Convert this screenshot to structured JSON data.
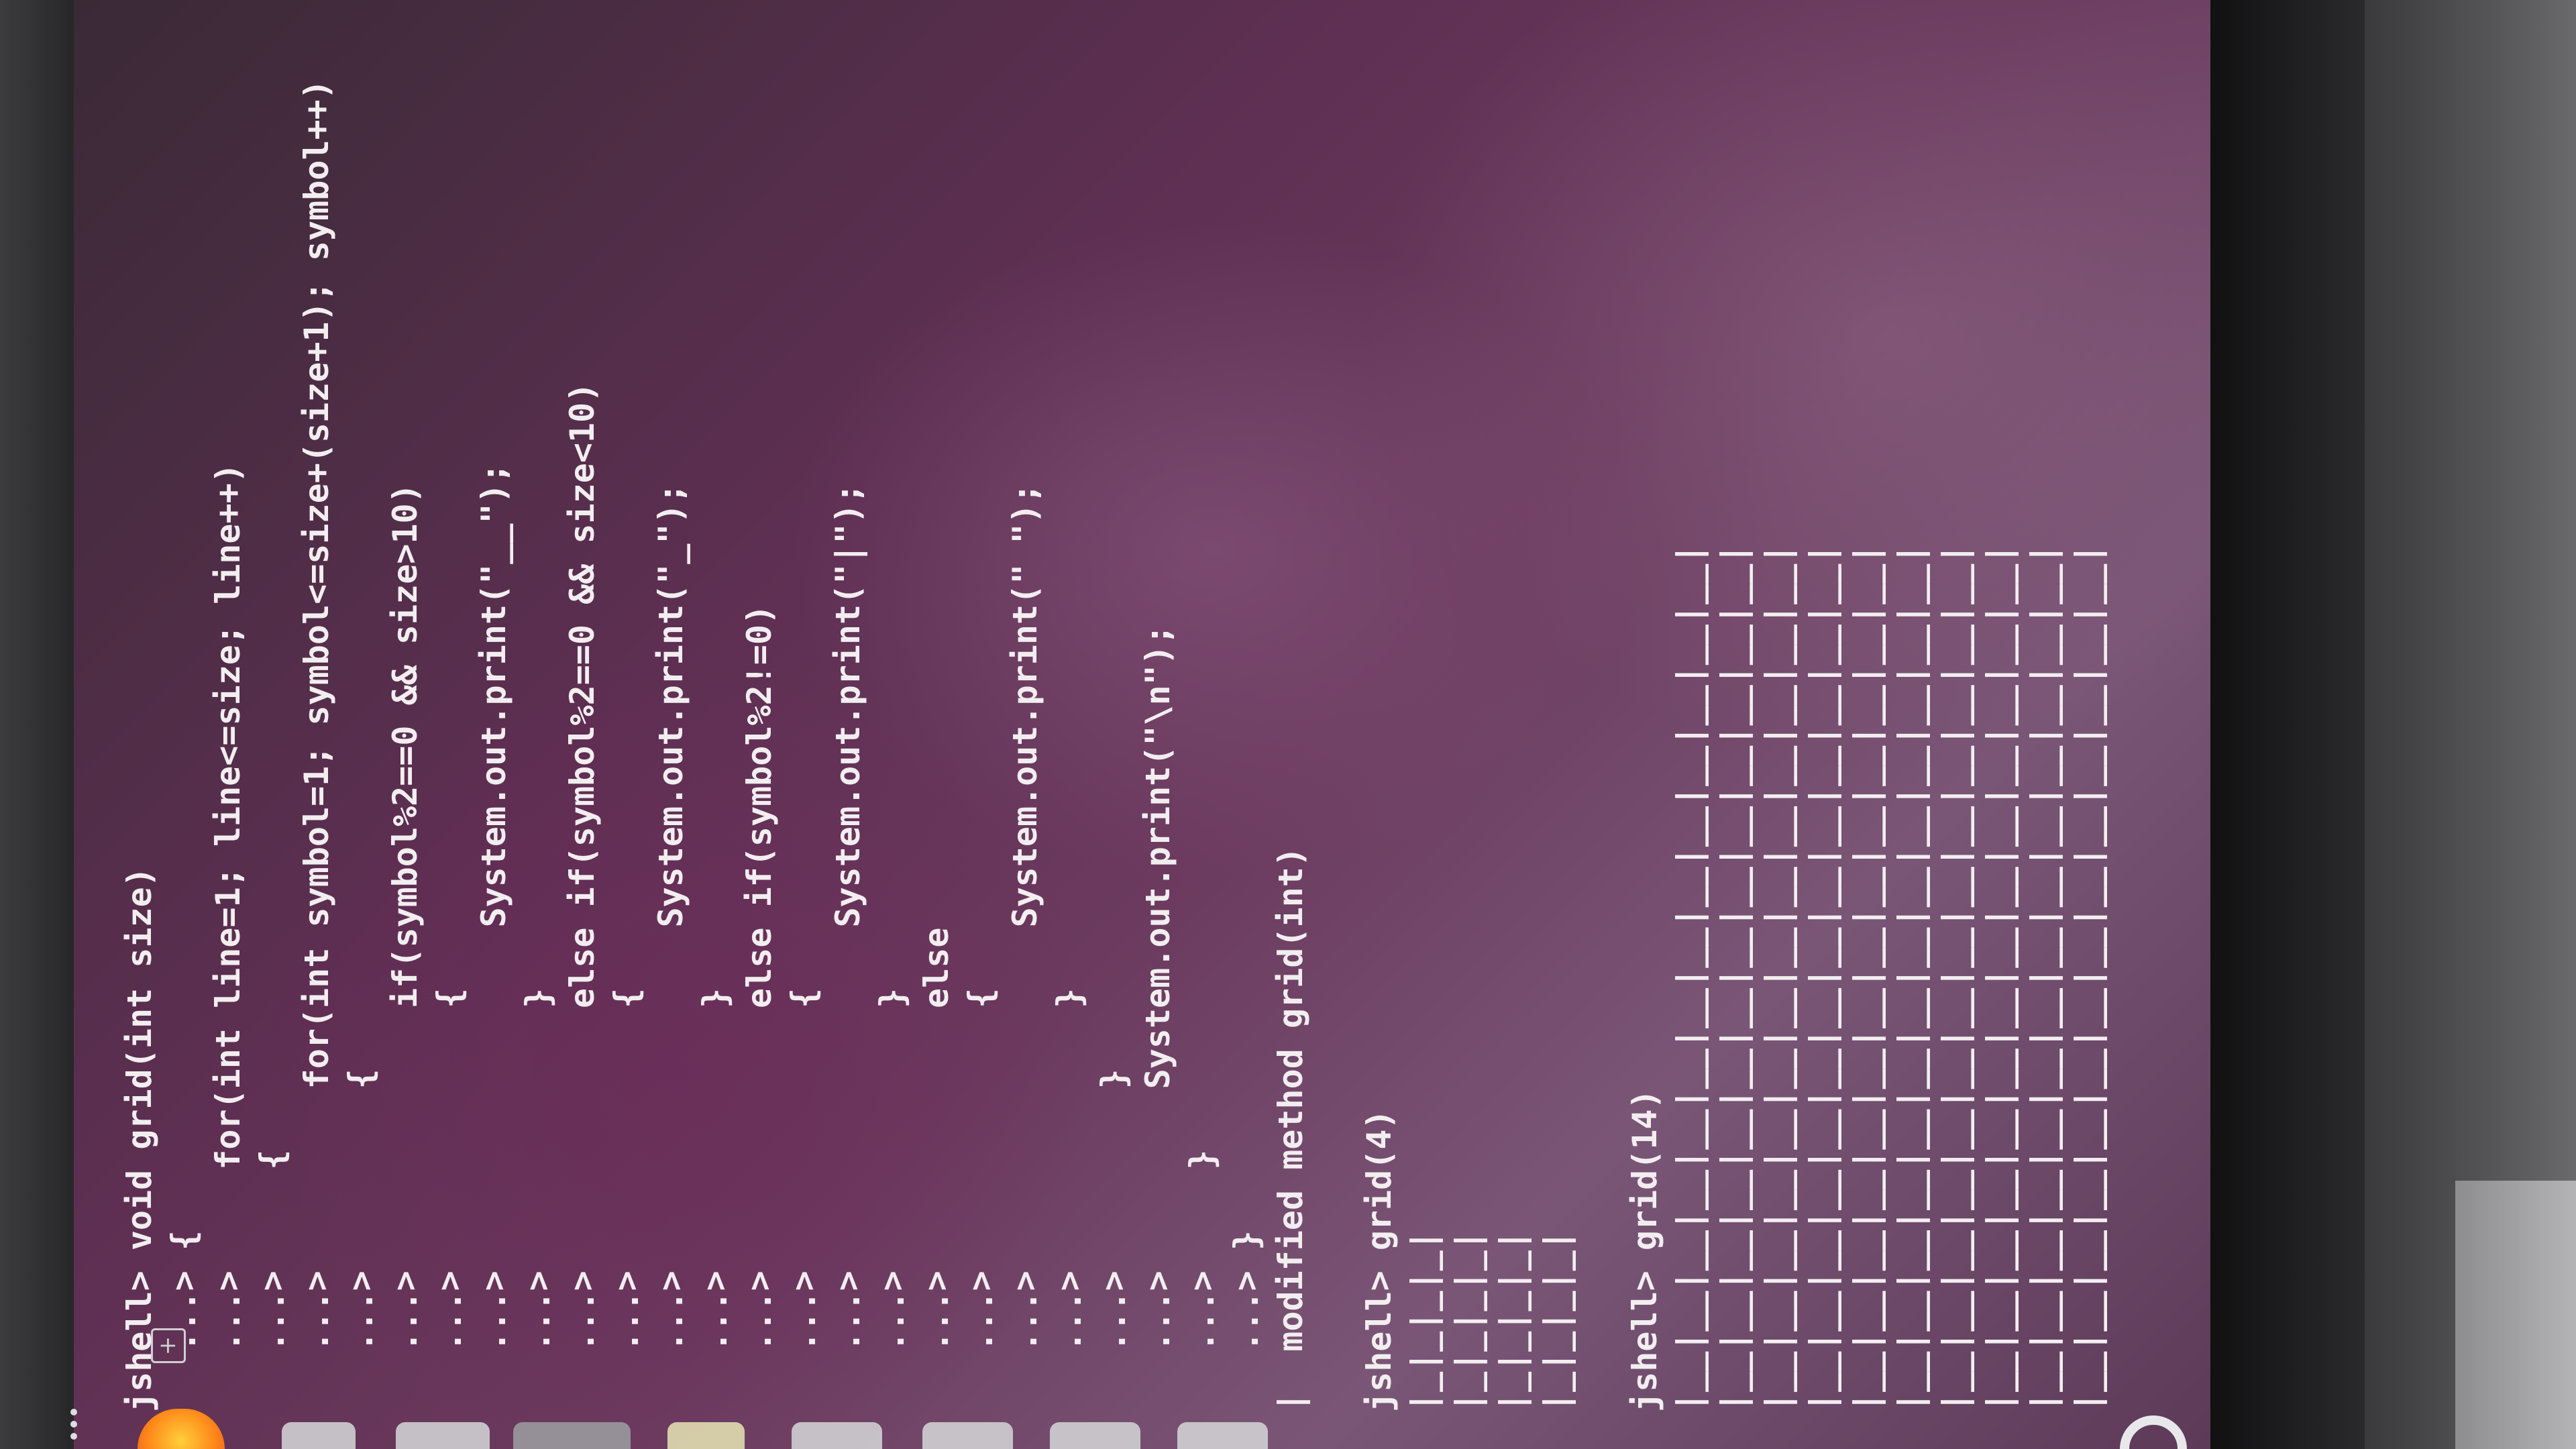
{
  "terminal": {
    "lines": [
      {
        "text": "jshell> void grid(int size)"
      },
      {
        "text": "   ...> {"
      },
      {
        "text": "   ...>     for(int line=1; line<=size; line++)"
      },
      {
        "text": "   ...>     {"
      },
      {
        "text": "   ...>         for(int symbol=1; symbol<=size+(size+1); symbol++)"
      },
      {
        "text": "   ...>         {"
      },
      {
        "text": "   ...>             if(symbol%2==0 && size>10)"
      },
      {
        "text": "   ...>             {"
      },
      {
        "text": "   ...>                 System.out.print(\"__\");"
      },
      {
        "text": "   ...>             }"
      },
      {
        "text": "   ...>             else if(symbol%2==0 && size<10)"
      },
      {
        "text": "   ...>             {"
      },
      {
        "text": "   ...>                 System.out.print(\"_\");"
      },
      {
        "text": "   ...>             }"
      },
      {
        "text": "   ...>             else if(symbol%2!=0)"
      },
      {
        "text": "   ...>             {"
      },
      {
        "text": "   ...>                 System.out.print(\"|\");"
      },
      {
        "text": "   ...>             }"
      },
      {
        "text": "   ...>             else"
      },
      {
        "text": "   ...>             {"
      },
      {
        "text": "   ...>                 System.out.print(\" \");"
      },
      {
        "text": "   ...>             }"
      },
      {
        "text": "   ...>         }"
      },
      {
        "text": "   ...>         System.out.print(\"\\n\");"
      },
      {
        "text": "   ...>     }"
      },
      {
        "text": "   ...> }"
      },
      {
        "text": "|  modified method grid(int)"
      },
      {
        "text": ""
      },
      {
        "text": "jshell> grid(4)"
      },
      {
        "text": "|_|_|_|_|"
      },
      {
        "text": "|_|_|_|_|"
      },
      {
        "text": "|_|_|_|_|"
      },
      {
        "text": "|_|_|_|_|"
      },
      {
        "text": ""
      },
      {
        "text": "jshell> grid(14)"
      },
      {
        "text": "|__|__|__|__|__|__|__|__|__|__|__|__|__|__|"
      },
      {
        "text": "|__|__|__|__|__|__|__|__|__|__|__|__|__|__|"
      },
      {
        "text": "|__|__|__|__|__|__|__|__|__|__|__|__|__|__|"
      },
      {
        "text": "|__|__|__|__|__|__|__|__|__|__|__|__|__|__|"
      },
      {
        "text": "|__|__|__|__|__|__|__|__|__|__|__|__|__|__|"
      },
      {
        "text": "|__|__|__|__|__|__|__|__|__|__|__|__|__|__|"
      },
      {
        "text": "|__|__|__|__|__|__|__|__|__|__|__|__|__|__|"
      },
      {
        "text": "|__|__|__|__|__|__|__|__|__|__|__|__|__|__|"
      },
      {
        "text": "|__|__|__|__|__|__|__|__|__|__|__|__|__|__|"
      },
      {
        "text": "|__|__|__|__|__|__|__|__|__|__|__|__|__|__|"
      }
    ]
  },
  "icons": {
    "new_tab": "new-tab-icon",
    "browser": "firefox-icon",
    "help": "help-icon"
  },
  "colors": {
    "terminal_text": "#f2eef0",
    "wallpaper_base": "#5e2f52"
  }
}
